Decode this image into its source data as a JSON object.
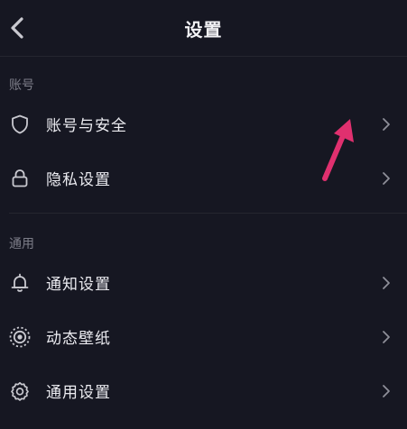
{
  "header": {
    "title": "设置",
    "back_icon": "chevron-left-icon"
  },
  "sections": [
    {
      "label": "账号",
      "items": [
        {
          "label": "账号与安全",
          "icon": "shield-icon"
        },
        {
          "label": "隐私设置",
          "icon": "lock-icon"
        }
      ]
    },
    {
      "label": "通用",
      "items": [
        {
          "label": "通知设置",
          "icon": "bell-icon"
        },
        {
          "label": "动态壁纸",
          "icon": "live-wallpaper-icon"
        },
        {
          "label": "通用设置",
          "icon": "gear-icon"
        }
      ]
    }
  ],
  "colors": {
    "background": "#161722",
    "text": "#ececf1",
    "muted": "#7d7e89",
    "annotation": "#e0306f"
  }
}
